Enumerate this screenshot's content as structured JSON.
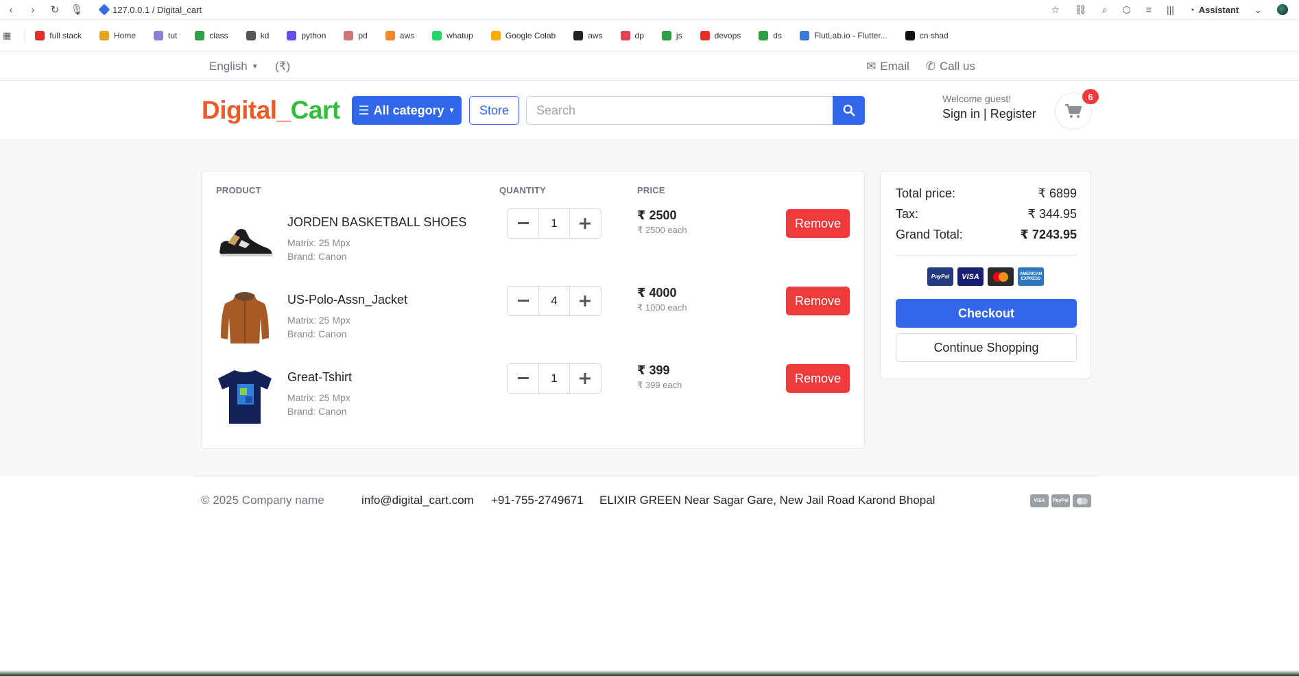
{
  "browser": {
    "url": "127.0.0.1 / Digital_cart",
    "assistant_label": "Assistant",
    "bookmarks": [
      {
        "label": "full stack",
        "color": "#e52d27"
      },
      {
        "label": "Home",
        "color": "#e2a51f"
      },
      {
        "label": "tut",
        "color": "#8b7fd6"
      },
      {
        "label": "class",
        "color": "#2f9e44"
      },
      {
        "label": "kd",
        "color": "#555555"
      },
      {
        "label": "python",
        "color": "#6a4cf0"
      },
      {
        "label": "pd",
        "color": "#c77"
      },
      {
        "label": "aws",
        "color": "#f08a24"
      },
      {
        "label": "whatup",
        "color": "#25d366"
      },
      {
        "label": "Google Colab",
        "color": "#f9ab00"
      },
      {
        "label": "aws",
        "color": "#222222"
      },
      {
        "label": "dp",
        "color": "#e0435a"
      },
      {
        "label": "js",
        "color": "#2f9e44"
      },
      {
        "label": "devops",
        "color": "#e52d27"
      },
      {
        "label": "ds",
        "color": "#2f9e44"
      },
      {
        "label": "FlutLab.io - Flutter...",
        "color": "#3a7bd5"
      },
      {
        "label": "cn shad",
        "color": "#111111"
      }
    ]
  },
  "topbar": {
    "language": "English",
    "currency": "(₹)",
    "email": "Email",
    "call": "Call us"
  },
  "header": {
    "logo_part1": "Digital",
    "logo_sep": "_",
    "logo_part2": "Cart",
    "category_button": "All category",
    "store_button": "Store",
    "search_placeholder": "Search",
    "welcome": "Welcome guest!",
    "sign_in": "Sign in",
    "register": "Register",
    "cart_count": "6"
  },
  "cart": {
    "headers": {
      "product": "PRODUCT",
      "quantity": "QUANTITY",
      "price": "PRICE"
    },
    "items": [
      {
        "name": "JORDEN BASKETBALL SHOES",
        "matrix": "Matrix: 25 Mpx",
        "brand": "Brand: Canon",
        "qty": "1",
        "price": "₹ 2500",
        "each": "₹ 2500 each",
        "remove": "Remove"
      },
      {
        "name": "US-Polo-Assn_Jacket",
        "matrix": "Matrix: 25 Mpx",
        "brand": "Brand: Canon",
        "qty": "4",
        "price": "₹ 4000",
        "each": "₹ 1000 each",
        "remove": "Remove"
      },
      {
        "name": "Great-Tshirt",
        "matrix": "Matrix: 25 Mpx",
        "brand": "Brand: Canon",
        "qty": "1",
        "price": "₹ 399",
        "each": "₹ 399 each",
        "remove": "Remove"
      }
    ]
  },
  "summary": {
    "total_label": "Total price:",
    "total_value": "₹ 6899",
    "tax_label": "Tax:",
    "tax_value": "₹ 344.95",
    "grand_label": "Grand Total:",
    "grand_value": "₹ 7243.95",
    "checkout": "Checkout",
    "continue": "Continue Shopping",
    "pay_icons": [
      "PayPal",
      "VISA",
      "mastercard",
      "AMERICAN EXPRESS"
    ]
  },
  "footer": {
    "copyright": "© 2025 Company name",
    "email": "info@digital_cart.com",
    "phone": "+91-755-2749671",
    "address": "ELIXIR GREEN Near Sagar Gare, New Jail Road Karond Bhopal",
    "pay_icons": [
      "VISA",
      "PayPal",
      "mastercard"
    ]
  }
}
